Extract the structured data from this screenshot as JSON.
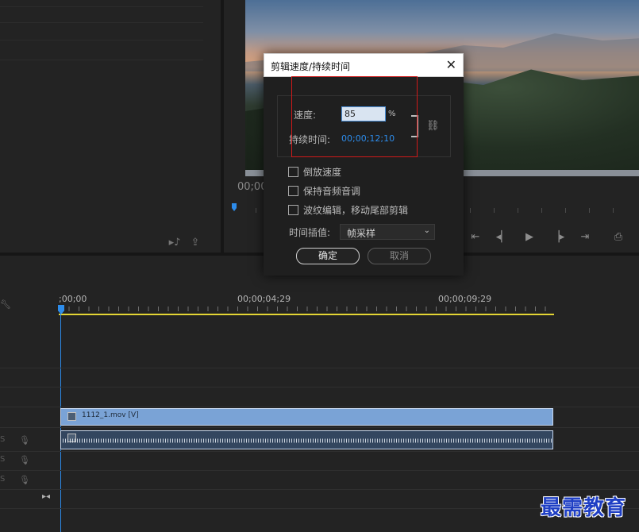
{
  "program_monitor": {
    "timecode": "00;00"
  },
  "timeline": {
    "ruler_times": [
      ";00;00",
      "00;00;04;29",
      "00;00;09;29"
    ],
    "video_clip_name": "1112_1.mov [V]",
    "track_tags": [
      "S",
      "S",
      "S"
    ]
  },
  "dialog": {
    "title": "剪辑速度/持续时间",
    "close_glyph": "✕",
    "speed_label": "速度:",
    "speed_value": "85",
    "speed_unit": "%",
    "duration_label": "持续时间:",
    "duration_value": "00;00;12;10",
    "checkboxes": [
      {
        "label": "倒放速度",
        "checked": false
      },
      {
        "label": "保持音频音调",
        "checked": false
      },
      {
        "label": "波纹编辑，移动尾部剪辑",
        "checked": false
      }
    ],
    "interp_label": "时间插值:",
    "interp_value": "帧采样",
    "ok_label": "确定",
    "cancel_label": "取消"
  },
  "watermark": "最需教育",
  "icons": {
    "link": "chain-unlink-icon",
    "transport": [
      "step-to-in-icon",
      "step-back-icon",
      "play-icon",
      "step-forward-icon",
      "step-to-out-icon",
      "export-frame-icon"
    ]
  },
  "colors": {
    "accent": "#2d8ceb",
    "video_clip": "#7aa3d6",
    "audio_clip": "#33465f",
    "work_area": "#e3d534",
    "highlight": "#d01a1a",
    "watermark": "#1f3fc4"
  }
}
